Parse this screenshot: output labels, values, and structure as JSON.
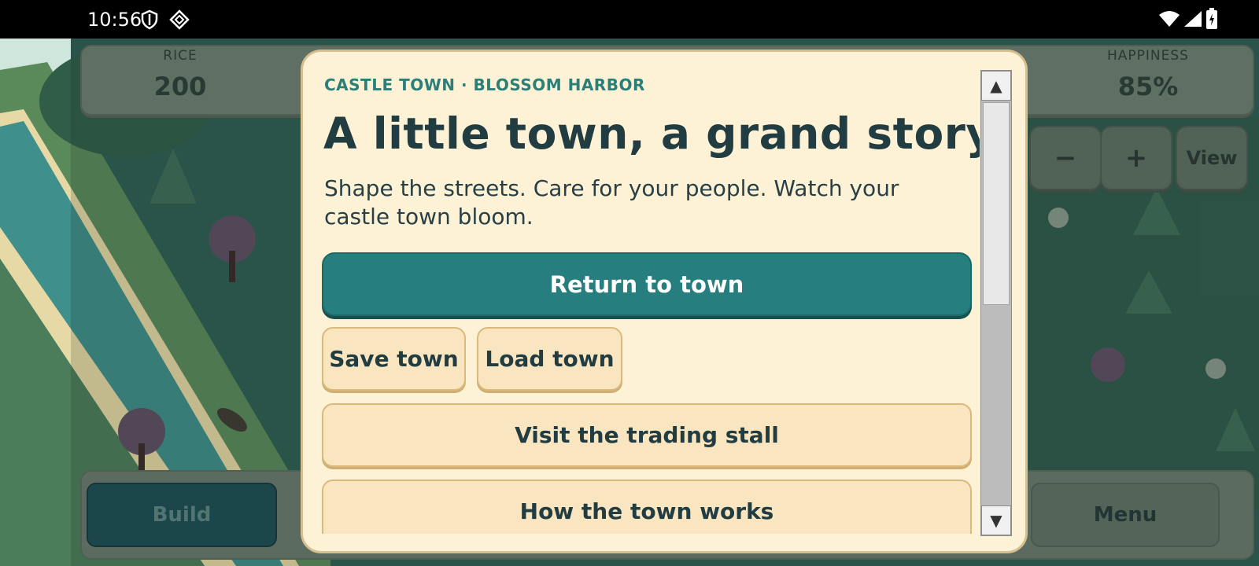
{
  "status_bar": {
    "time": "10:56"
  },
  "hud": {
    "stats": [
      {
        "label": "RICE",
        "value": "200"
      },
      {
        "label": "HAPPINESS",
        "value": "85%"
      }
    ],
    "zoom_out": "−",
    "zoom_in": "+",
    "view": "View",
    "build": "Build",
    "menu": "Menu"
  },
  "modal": {
    "eyebrow": "CASTLE TOWN · BLOSSOM HARBOR",
    "title": "A little town, a grand story",
    "description": "Shape the streets. Care for your people. Watch your castle town bloom.",
    "return_button": "Return to town",
    "save_button": "Save town",
    "load_button": "Load town",
    "trade_button": "Visit the trading stall",
    "howto_button": "How the town works",
    "scroll_up": "▲",
    "scroll_down": "▼"
  },
  "colors": {
    "accent": "#267f7e",
    "panel": "#fdf1d6",
    "title": "#223d42"
  }
}
